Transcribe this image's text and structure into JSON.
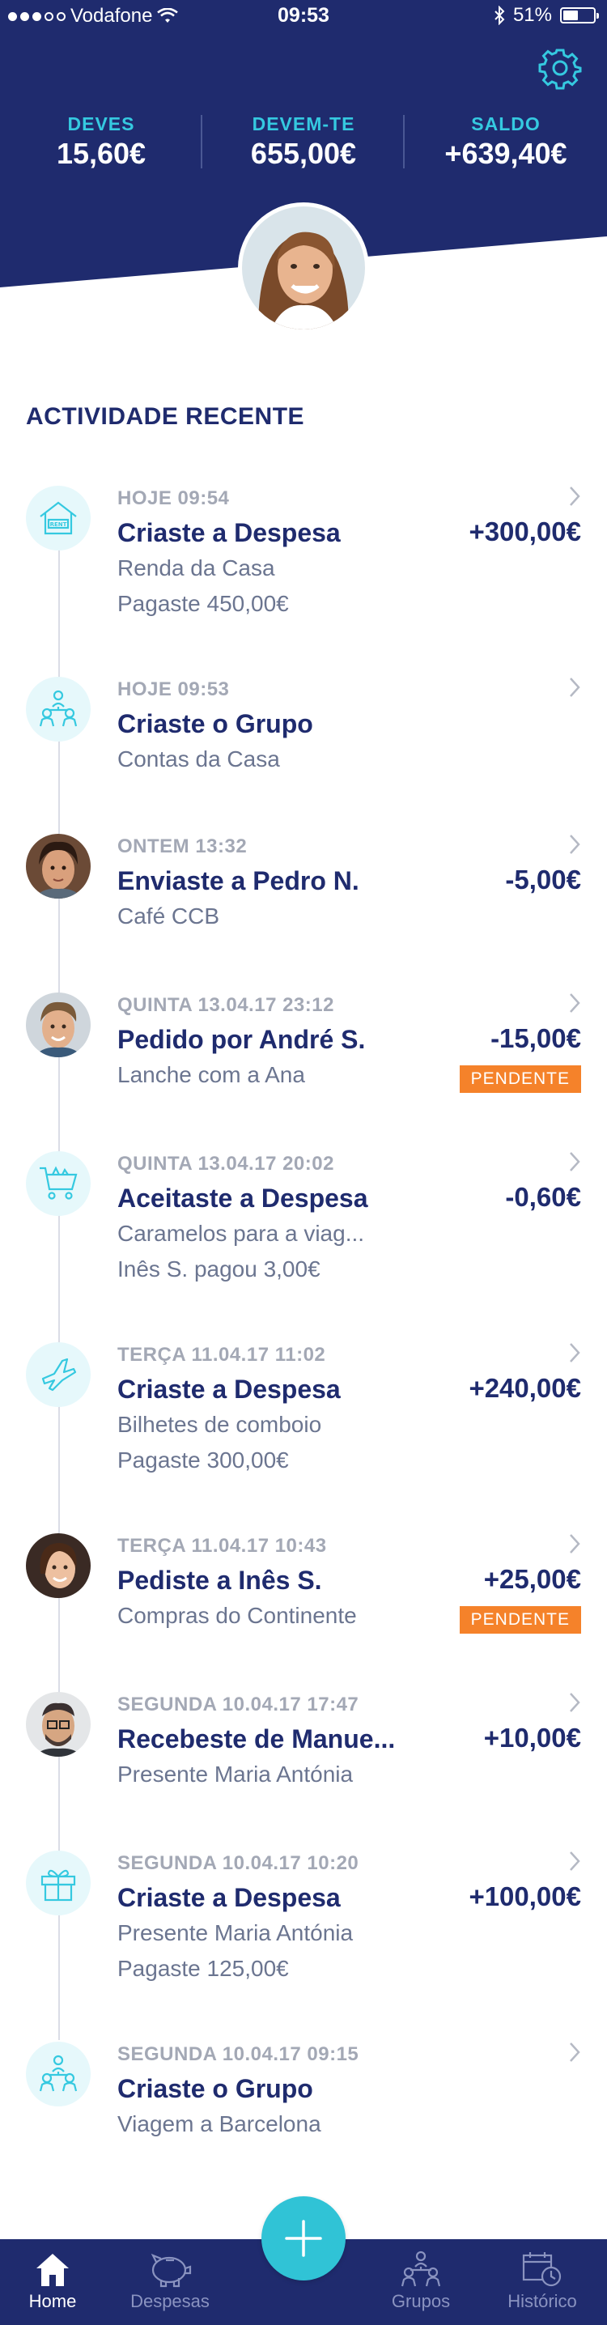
{
  "status_bar": {
    "carrier": "Vodafone",
    "time": "09:53",
    "battery": "51%",
    "battery_level": 0.51
  },
  "summary": {
    "owe": {
      "label": "DEVES",
      "value": "15,60€"
    },
    "owed": {
      "label": "DEVEM-TE",
      "value": "655,00€"
    },
    "balance": {
      "label": "SALDO",
      "value": "+639,40€"
    }
  },
  "activity": {
    "title": "ACTIVIDADE RECENTE",
    "items": [
      {
        "time": "HOJE 09:54",
        "title": "Criaste a Despesa",
        "sub1": "Renda da Casa",
        "sub2": "Pagaste 450,00€",
        "amount": "+300,00€",
        "badge": "",
        "icon": "rent-house-icon"
      },
      {
        "time": "HOJE 09:53",
        "title": "Criaste o Grupo",
        "sub1": "Contas da Casa",
        "sub2": "",
        "amount": "",
        "badge": "",
        "icon": "group-icon"
      },
      {
        "time": "ONTEM 13:32",
        "title": "Enviaste a Pedro N.",
        "sub1": "Café CCB",
        "sub2": "",
        "amount": "-5,00€",
        "badge": "",
        "icon": "avatar-pedro"
      },
      {
        "time": "QUINTA 13.04.17 23:12",
        "title": "Pedido por André S.",
        "sub1": "Lanche com a Ana",
        "sub2": "",
        "amount": "-15,00€",
        "badge": "PENDENTE",
        "icon": "avatar-andre"
      },
      {
        "time": "QUINTA 13.04.17 20:02",
        "title": "Aceitaste a Despesa",
        "sub1": "Caramelos para a viag...",
        "sub2": "Inês S. pagou 3,00€",
        "amount": "-0,60€",
        "badge": "",
        "icon": "shopping-cart-icon"
      },
      {
        "time": "TERÇA 11.04.17 11:02",
        "title": "Criaste a Despesa",
        "sub1": "Bilhetes de comboio",
        "sub2": "Pagaste 300,00€",
        "amount": "+240,00€",
        "badge": "",
        "icon": "airplane-icon"
      },
      {
        "time": "TERÇA 11.04.17 10:43",
        "title": "Pediste a Inês S.",
        "sub1": "Compras do Continente",
        "sub2": "",
        "amount": "+25,00€",
        "badge": "PENDENTE",
        "icon": "avatar-ines"
      },
      {
        "time": "SEGUNDA 10.04.17 17:47",
        "title": "Recebeste de Manue...",
        "sub1": "Presente Maria Antónia",
        "sub2": "",
        "amount": "+10,00€",
        "badge": "",
        "icon": "avatar-manuel"
      },
      {
        "time": "SEGUNDA 10.04.17 10:20",
        "title": "Criaste a Despesa",
        "sub1": "Presente Maria Antónia",
        "sub2": "Pagaste 125,00€",
        "amount": "+100,00€",
        "badge": "",
        "icon": "gift-icon"
      },
      {
        "time": "SEGUNDA 10.04.17 09:15",
        "title": "Criaste o Grupo",
        "sub1": "Viagem a Barcelona",
        "sub2": "",
        "amount": "",
        "badge": "",
        "icon": "group-icon"
      }
    ]
  },
  "tabbar": {
    "home": "Home",
    "expenses": "Despesas",
    "groups": "Grupos",
    "history": "Histórico"
  },
  "colors": {
    "navy": "#1f2b6e",
    "cyan": "#30c3d6",
    "orange_badge": "#f5822a",
    "icon_bg": "#e6f8fb"
  }
}
